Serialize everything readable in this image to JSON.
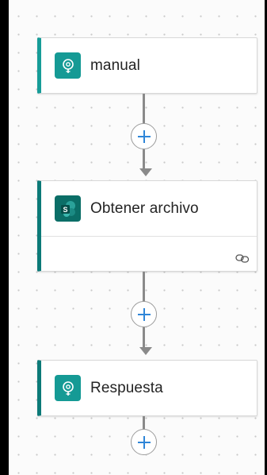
{
  "steps": [
    {
      "title": "manual",
      "icon": "request-trigger-icon",
      "accent": "#169c98"
    },
    {
      "title": "Obtener archivo",
      "icon": "sharepoint-icon",
      "accent": "#0c7a78"
    },
    {
      "title": "Respuesta",
      "icon": "request-response-icon",
      "accent": "#0c7a78"
    }
  ],
  "colors": {
    "plus": "#2f86d8",
    "connector": "#8a8a8a",
    "canvas": "#fbfbfb"
  }
}
